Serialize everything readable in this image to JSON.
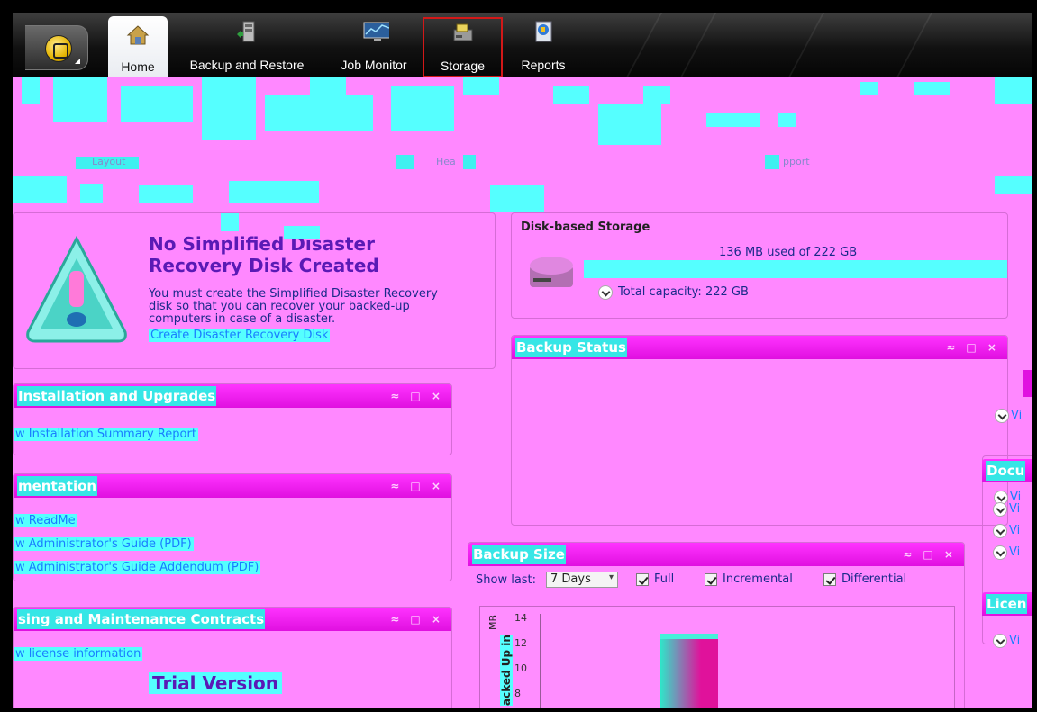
{
  "nav": {
    "tabs": [
      {
        "label": "Home",
        "icon": "home-icon",
        "active": true
      },
      {
        "label": "Backup and Restore",
        "icon": "backup-restore-icon"
      },
      {
        "label": "Job Monitor",
        "icon": "job-monitor-icon"
      },
      {
        "label": "Storage",
        "icon": "storage-icon",
        "highlighted": true
      },
      {
        "label": "Reports",
        "icon": "reports-icon"
      }
    ]
  },
  "top_strip": {
    "labels": [
      "Layout",
      "Hea",
      "pport"
    ]
  },
  "sdr": {
    "heading_line1": "No Simplified Disaster",
    "heading_line2": "Recovery Disk Created",
    "body": [
      "You must create the Simplified Disaster Recovery",
      "disk so that you can recover your backed-up",
      "computers in case of a disaster."
    ],
    "link": "Create Disaster Recovery Disk"
  },
  "storage": {
    "title": "Disk-based Storage",
    "usage": "136 MB used of 222 GB",
    "capacity": "Total capacity: 222 GB"
  },
  "backup_status": {
    "title": "Backup Status"
  },
  "installation": {
    "title": "Installation and Upgrades",
    "link": "w Installation Summary Report"
  },
  "documentation": {
    "title": "mentation",
    "links": [
      "w ReadMe",
      "w Administrator's Guide (PDF)",
      "w Administrator's Guide Addendum (PDF)"
    ]
  },
  "licensing": {
    "title": "sing and Maintenance Contracts",
    "link": "w license information",
    "trial": "Trial Version"
  },
  "backup_size": {
    "title": "Backup Size",
    "show_last_label": "Show last:",
    "range": "7 Days",
    "filters": [
      "Full",
      "Incremental",
      "Differential"
    ],
    "y_unit": "MB",
    "y_label": "acked Up in",
    "y_ticks": [
      "14",
      "12",
      "10",
      "8"
    ]
  },
  "right_col": {
    "doc_title": "Docu",
    "lic_title": "Licen",
    "view": "Vi"
  },
  "colors": {
    "panel_title": "#e010e0",
    "link": "#1a7eff",
    "distortion_cyan": "#55ffff",
    "background": "#ff88ff"
  }
}
